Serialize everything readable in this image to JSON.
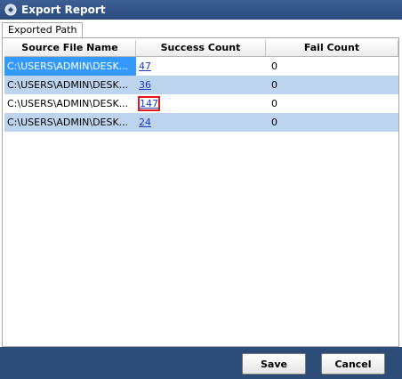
{
  "window": {
    "title": "Export Report"
  },
  "tabs": [
    {
      "label": "Exported Path"
    }
  ],
  "table": {
    "columns": [
      "Source File Name",
      "Success Count",
      "Fail Count"
    ],
    "rows": [
      {
        "source": "C:\\USERS\\ADMIN\\DESK...",
        "success": "47",
        "fail": "0"
      },
      {
        "source": "C:\\USERS\\ADMIN\\DESK...",
        "success": "36",
        "fail": "0"
      },
      {
        "source": "C:\\USERS\\ADMIN\\DESK...",
        "success": "147",
        "fail": "0"
      },
      {
        "source": "C:\\USERS\\ADMIN\\DESK...",
        "success": "24",
        "fail": "0"
      }
    ]
  },
  "buttons": {
    "save": "Save",
    "cancel": "Cancel"
  },
  "colors": {
    "titlebar": "#2c4c80",
    "footer": "#2e4c78",
    "row_alt": "#bdd4ee",
    "selection": "#3399ff",
    "link": "#1a3cc8",
    "highlight": "#e01818"
  },
  "icons": {
    "app": "app-logo-icon"
  }
}
